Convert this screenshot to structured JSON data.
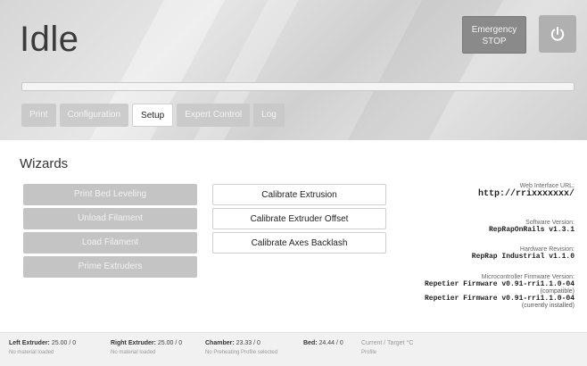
{
  "header": {
    "status": "Idle",
    "emergency_line1": "Emergency",
    "emergency_line2": "STOP",
    "progress_fraction": 0.0
  },
  "tabs": [
    {
      "label": "Print",
      "active": false
    },
    {
      "label": "Configuration",
      "active": false
    },
    {
      "label": "Setup",
      "active": true
    },
    {
      "label": "Expert Control",
      "active": false
    },
    {
      "label": "Log",
      "active": false
    }
  ],
  "wizards": {
    "title": "Wizards",
    "left": [
      {
        "label": "Print Bed Leveling",
        "enabled": false
      },
      {
        "label": "Unload Filament",
        "enabled": false
      },
      {
        "label": "Load Filament",
        "enabled": false
      },
      {
        "label": "Prime Extruders",
        "enabled": false
      }
    ],
    "middle": [
      {
        "label": "Calibrate Extrusion",
        "enabled": true
      },
      {
        "label": "Calibrate Extruder Offset",
        "enabled": true
      },
      {
        "label": "Calibrate Axes Backlash",
        "enabled": true
      }
    ]
  },
  "info": {
    "web_label": "Web Interface URL:",
    "web_value": "http://rrixxxxxxx/",
    "software_label": "Software Version:",
    "software_value": "RepRapOnRails v1.3.1",
    "hardware_label": "Hardware Revision:",
    "hardware_value": "RepRap Industrial v1.1.0",
    "firmware_label": "Microcontroller Firmware Version:",
    "firmware_value1": "Repetier Firmware v0.91-rri1.1.0-04",
    "firmware_note1": "(compatible)",
    "firmware_value2": "Repetier Firmware v0.91-rri1.1.0-04",
    "firmware_note2": "(currently installed)"
  },
  "footer": {
    "left_label": "Left Extruder:",
    "left_value": "25.00 / 0",
    "left_sub": "No material loaded",
    "right_label": "Right Extruder:",
    "right_value": "25.00 / 0",
    "right_sub": "No material loaded",
    "chamber_label": "Chamber:",
    "chamber_value": "23.33 / 0",
    "chamber_sub": "No Preheating Profile selected",
    "bed_label": "Bed:",
    "bed_value": "24.44 / 0",
    "legend_line1": "Current / Target °C",
    "legend_line2": "Profile"
  }
}
